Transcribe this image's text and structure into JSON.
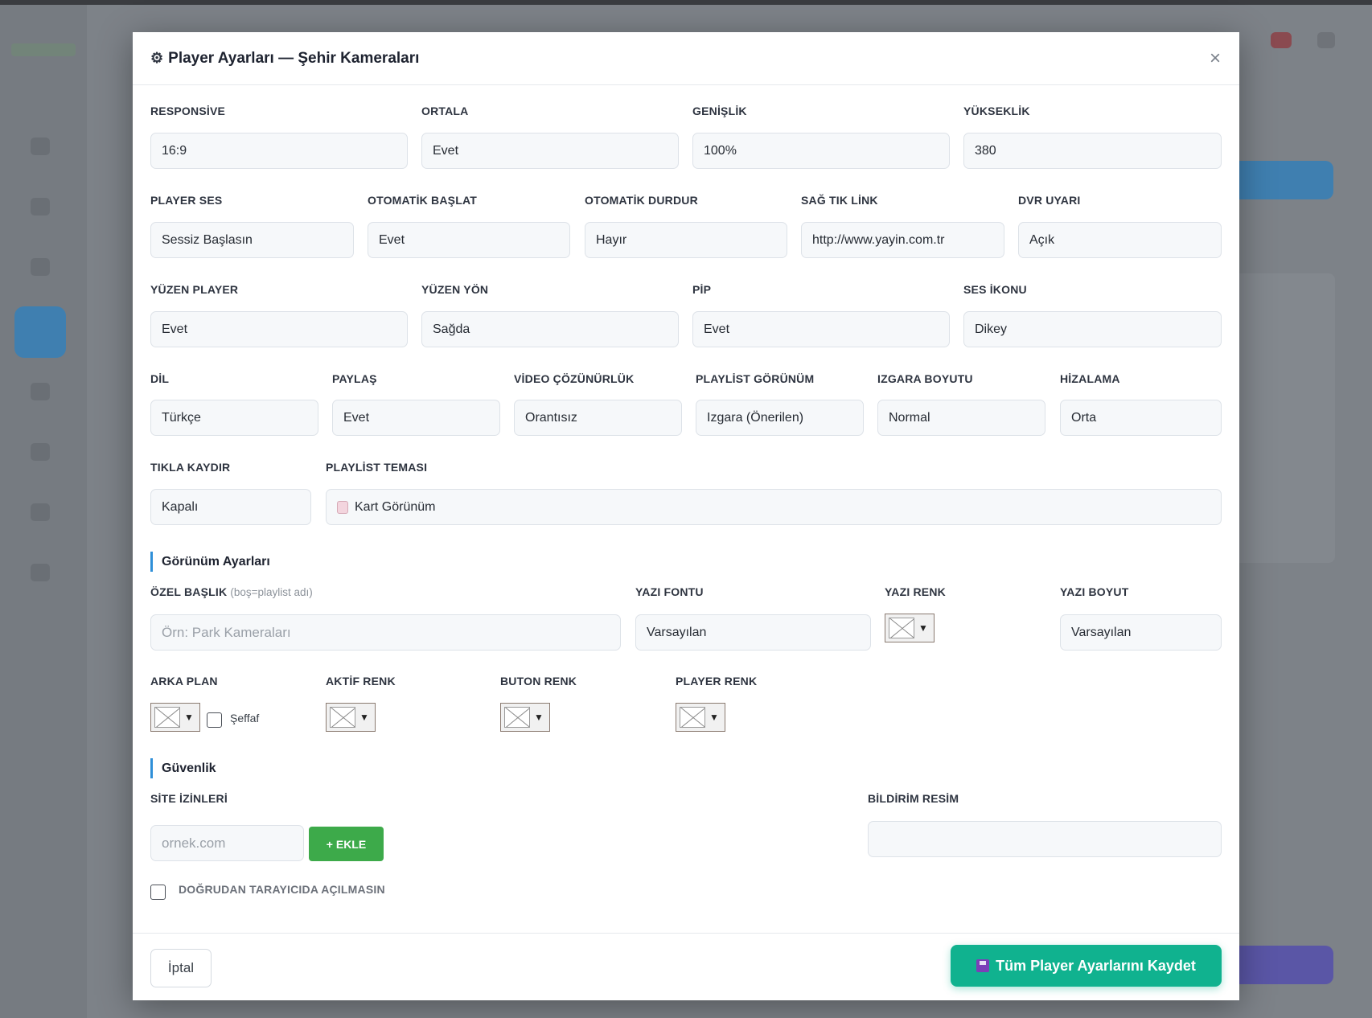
{
  "modal": {
    "title": "Player Ayarları — Şehir Kameraları",
    "close_label": "×"
  },
  "fields": {
    "responsive": {
      "label": "RESPONSİVE",
      "value": "16:9"
    },
    "ortala": {
      "label": "ORTALA",
      "value": "Evet"
    },
    "genislik": {
      "label": "GENİŞLİK",
      "value": "100%"
    },
    "yukseklik": {
      "label": "YÜKSEKLİK",
      "value": "380"
    },
    "player_ses": {
      "label": "PLAYER SES",
      "value": "Sessiz Başlasın"
    },
    "otomatik_baslat": {
      "label": "OTOMATİK BAŞLAT",
      "value": "Evet"
    },
    "otomatik_durdur": {
      "label": "OTOMATİK DURDUR",
      "value": "Hayır"
    },
    "sag_tik_link": {
      "label": "SAĞ TIK LİNK",
      "value": "http://www.yayin.com.tr"
    },
    "dvr_uyari": {
      "label": "DVR UYARI",
      "value": "Açık"
    },
    "yuzen_player": {
      "label": "YÜZEN PLAYER",
      "value": "Evet"
    },
    "yuzen_yon": {
      "label": "YÜZEN YÖN",
      "value": "Sağda"
    },
    "pip": {
      "label": "PİP",
      "value": "Evet"
    },
    "ses_ikonu": {
      "label": "SES İKONU",
      "value": "Dikey"
    },
    "dil": {
      "label": "DİL",
      "value": "Türkçe"
    },
    "paylas": {
      "label": "PAYLAŞ",
      "value": "Evet"
    },
    "video_cozunurluk": {
      "label": "VİDEO ÇÖZÜNÜRLÜK",
      "value": "Orantısız"
    },
    "playlist_gorunum": {
      "label": "PLAYLİST GÖRÜNÜM",
      "value": "Izgara (Önerilen)"
    },
    "izgara_boyutu": {
      "label": "IZGARA BOYUTU",
      "value": "Normal"
    },
    "hizalama": {
      "label": "HİZALAMA",
      "value": "Orta"
    },
    "tikla_kaydir": {
      "label": "TIKLA KAYDIR",
      "value": "Kapalı"
    },
    "playlist_temasi": {
      "label": "PLAYLİST TEMASI",
      "value": "Kart Görünüm"
    }
  },
  "appearance": {
    "section_title": "Görünüm Ayarları",
    "ozel_baslik_label": "ÖZEL BAŞLIK",
    "ozel_baslik_hint": "(boş=playlist adı)",
    "ozel_baslik_placeholder": "Örn: Park Kameraları",
    "yazi_fontu_label": "YAZI FONTU",
    "yazi_fontu_value": "Varsayılan",
    "yazi_renk_label": "YAZI RENK",
    "yazi_boyut_label": "YAZI BOYUT",
    "yazi_boyut_value": "Varsayılan",
    "arka_plan_label": "ARKA PLAN",
    "seffaf_label": "Şeffaf",
    "aktif_renk_label": "AKTİF RENK",
    "buton_renk_label": "BUTON RENK",
    "player_renk_label": "PLAYER RENK"
  },
  "security": {
    "section_title": "Güvenlik",
    "site_izinleri_label": "SİTE İZİNLERİ",
    "site_placeholder": "ornek.com",
    "add_label": "+ EKLE",
    "bildirim_resim_label": "BİLDİRİM RESİM",
    "direct_block_label": "DOĞRUDAN TARAYICIDA AÇILMASIN"
  },
  "footer": {
    "cancel_label": "İptal",
    "save_label": "Tüm Player Ayarlarını Kaydet"
  },
  "colors": {
    "accent_blue": "#2f8fd8",
    "save_green": "#10b28f",
    "add_green": "#3daa4a"
  }
}
